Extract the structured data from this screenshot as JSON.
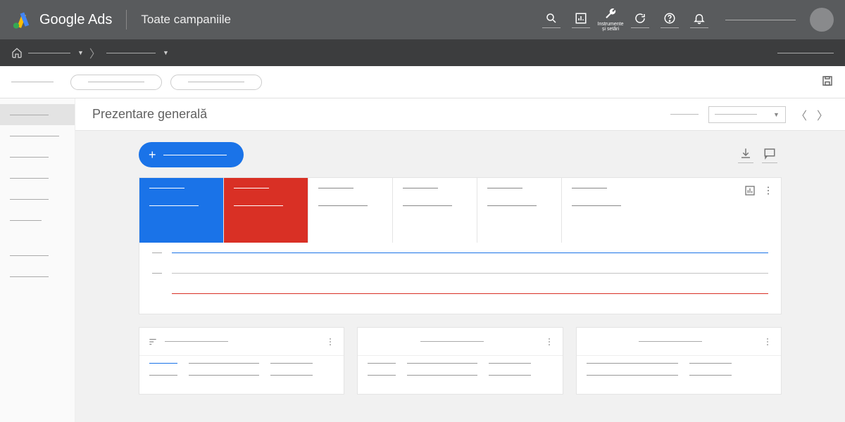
{
  "header": {
    "brand": "Google Ads",
    "scope": "Toate campaniile",
    "tools_label": "Instrumente și setări"
  },
  "page": {
    "title": "Prezentare generală"
  },
  "colors": {
    "blue": "#1a73e8",
    "red": "#d93025",
    "header_bg": "#595b5d",
    "crumb_bg": "#3c3d3e"
  }
}
